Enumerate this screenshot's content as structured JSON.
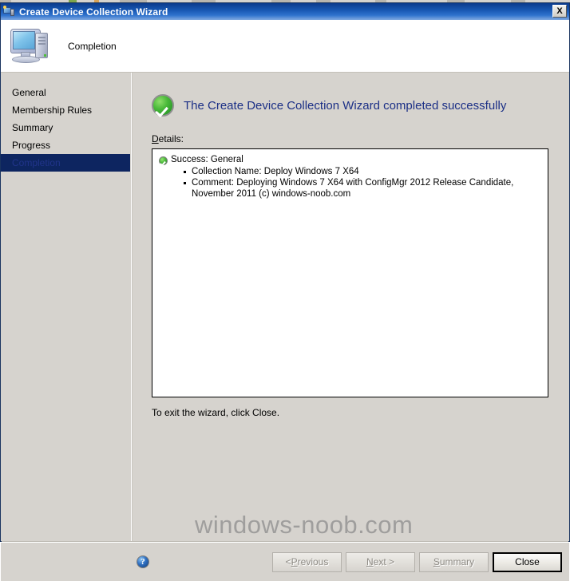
{
  "window": {
    "title": "Create Device Collection Wizard",
    "title_icon": "computer-wizard-icon",
    "close_glyph": "X",
    "accent_title_bar": "#0b3b8c",
    "dialog_background": "#d6d3ce"
  },
  "header": {
    "icon": "computer-icon",
    "step_title": "Completion"
  },
  "sidebar": {
    "items": [
      {
        "label": "General",
        "selected": false
      },
      {
        "label": "Membership Rules",
        "selected": false
      },
      {
        "label": "Summary",
        "selected": false
      },
      {
        "label": "Progress",
        "selected": false
      },
      {
        "label": "Completion",
        "selected": true
      }
    ],
    "selected_background": "#0d2560",
    "selected_text_color": "#21348a"
  },
  "main": {
    "status_icon": "success-check-icon",
    "heading": "The Create Device Collection Wizard completed successfully",
    "heading_color": "#1b2f86",
    "details_label_first_char": "D",
    "details_label_rest": "etails:",
    "details": {
      "status_icon": "success-check-icon",
      "status_line": "Success: General",
      "bullets": [
        "Collection Name: Deploy Windows 7 X64",
        "Comment: Deploying Windows 7 X64 with ConfigMgr 2012 Release Candidate, November 2011 (c) windows-noob.com"
      ]
    },
    "exit_instruction": "To exit the wizard, click Close."
  },
  "footer": {
    "help_icon": "help-question-icon",
    "help_glyph": "?",
    "buttons": [
      {
        "label_prefix": "< ",
        "mnemonic": "P",
        "label_suffix": "revious",
        "state": "disabled",
        "name": "previous-button"
      },
      {
        "label_prefix": "",
        "mnemonic": "N",
        "label_suffix": "ext >",
        "state": "disabled",
        "name": "next-button"
      },
      {
        "label_prefix": "",
        "mnemonic": "S",
        "label_suffix": "ummary",
        "state": "disabled",
        "name": "summary-button"
      },
      {
        "label_prefix": "",
        "mnemonic": "",
        "label_suffix": "Close",
        "state": "default",
        "name": "close-button"
      }
    ]
  },
  "watermark": {
    "text": "windows-noob.com",
    "color": "#8d8d8d"
  }
}
